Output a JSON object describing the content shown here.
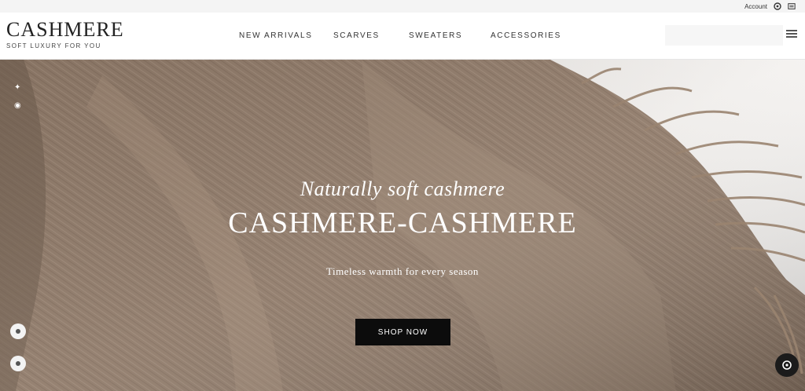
{
  "topbar": {
    "account_text": "Account",
    "icons": [
      "user-icon",
      "bag-icon"
    ]
  },
  "header": {
    "brand_name": "CASHMERE",
    "brand_tagline": "SOFT LUXURY FOR YOU",
    "nav": [
      {
        "label": "NEW ARRIVALS"
      },
      {
        "label": "SCARVES"
      },
      {
        "label": "SWEATERS"
      },
      {
        "label": "ACCESSORIES"
      }
    ],
    "search_placeholder": "",
    "menu_icon": "hamburger-menu-icon"
  },
  "hero": {
    "eyebrow": "Naturally soft cashmere",
    "title": "CASHMERE-CASHMERE",
    "subtitle": "Timeless warmth for every season",
    "cta_label": "SHOP NOW"
  },
  "colors": {
    "hero_base": "#8f7a69",
    "cta_bg": "#0c0c0c",
    "header_bg": "#ffffff"
  }
}
